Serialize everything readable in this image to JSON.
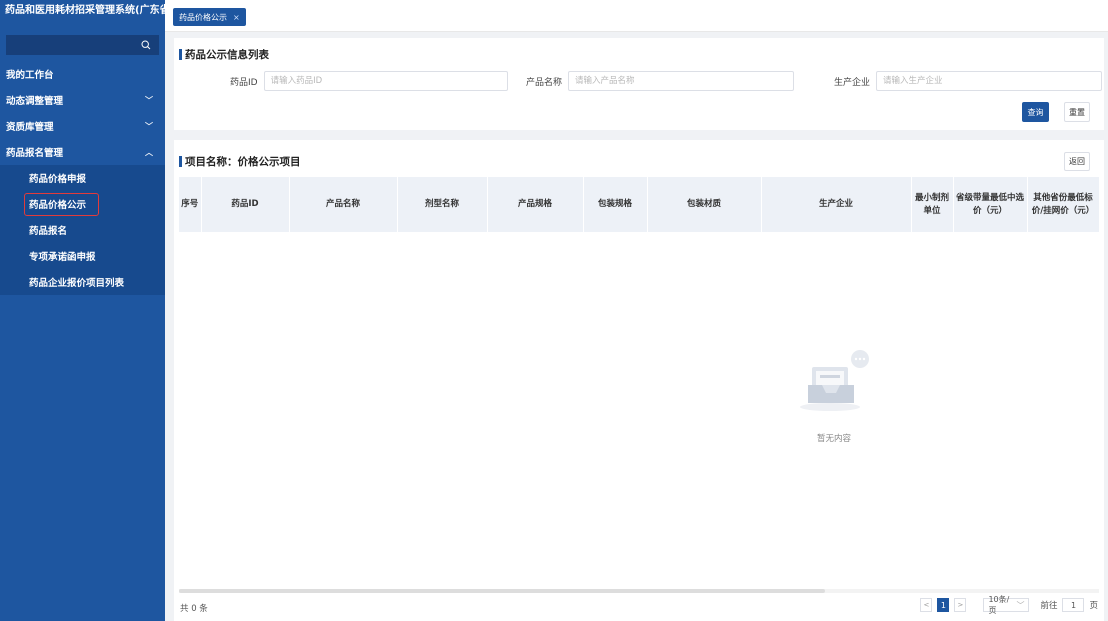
{
  "app": {
    "title": "药品和医用耗材招采管理系统(广东省)"
  },
  "sidebar": {
    "menu": [
      {
        "label": "我的工作台",
        "chevron": ""
      },
      {
        "label": "动态调整管理",
        "chevron": "﹀"
      },
      {
        "label": "资质库管理",
        "chevron": "﹀"
      },
      {
        "label": "药品报名管理",
        "chevron": "︿"
      }
    ],
    "submenu": [
      {
        "label": "药品价格申报"
      },
      {
        "label": "药品价格公示"
      },
      {
        "label": "药品报名"
      },
      {
        "label": "专项承诺函申报"
      },
      {
        "label": "药品企业报价项目列表"
      }
    ],
    "active_index": 1
  },
  "tabs": [
    {
      "label": "药品价格公示",
      "close": "×"
    }
  ],
  "search_panel": {
    "title": "药品公示信息列表",
    "fields": [
      {
        "label": "药品ID",
        "placeholder": "请输入药品ID"
      },
      {
        "label": "产品名称",
        "placeholder": "请输入产品名称"
      },
      {
        "label": "生产企业",
        "placeholder": "请输入生产企业"
      }
    ],
    "query_button": "查询",
    "reset_button": "重置"
  },
  "list_panel": {
    "title": "项目名称：价格公示项目",
    "back_button": "返回",
    "columns": [
      "序号",
      "药品ID",
      "产品名称",
      "剂型名称",
      "产品规格",
      "包装规格",
      "包装材质",
      "生产企业",
      "最小制剂单位",
      "省级带量最低中选价（元）",
      "其他省份最低标价/挂网价（元）"
    ],
    "empty_text": "暂无内容",
    "total_text": "共 0 条"
  },
  "pagination": {
    "current_page": "1",
    "page_size": "10条/页",
    "goto_label": "前往",
    "goto_value": "1",
    "page_unit": "页"
  },
  "colors": {
    "brand": "#1e56a0",
    "highlight": "#e23b3b"
  }
}
